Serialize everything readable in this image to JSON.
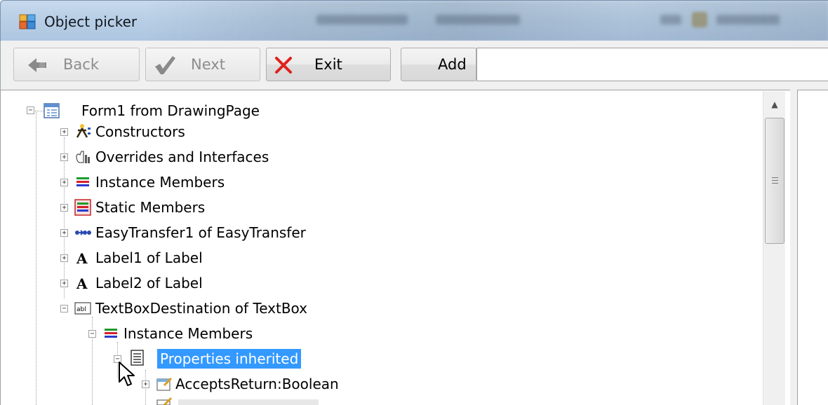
{
  "window": {
    "title": "Object picker"
  },
  "toolbar": {
    "back_label": "Back",
    "next_label": "Next",
    "exit_label": "Exit",
    "add_label": "Add",
    "address_value": ""
  },
  "tree": {
    "nodes": [
      {
        "label": "Form1 from DrawingPage",
        "icon": "form-icon",
        "expander": "−"
      },
      {
        "label": "Constructors",
        "icon": "constructors-icon",
        "expander": "+"
      },
      {
        "label": "Overrides and Interfaces",
        "icon": "overrides-icon",
        "expander": "+"
      },
      {
        "label": "Instance Members",
        "icon": "instance-members-icon",
        "expander": "+"
      },
      {
        "label": "Static Members",
        "icon": "static-members-icon",
        "expander": "+"
      },
      {
        "label": "EasyTransfer1 of EasyTransfer",
        "icon": "easytransfer-icon",
        "expander": "+"
      },
      {
        "label": "Label1 of Label",
        "icon": "label-icon",
        "expander": "+"
      },
      {
        "label": "Label2 of Label",
        "icon": "label-icon",
        "expander": "+"
      },
      {
        "label": "TextBoxDestination of TextBox",
        "icon": "textbox-icon",
        "expander": "−"
      },
      {
        "label": "Instance Members",
        "icon": "instance-members-icon",
        "expander": "−"
      },
      {
        "label": "Properties inherited",
        "icon": "properties-icon",
        "expander": "−",
        "selected": true
      },
      {
        "label": "AcceptsReturn:Boolean",
        "icon": "property-icon",
        "expander": "+"
      }
    ]
  },
  "colors": {
    "selection": "#3399ff",
    "exit_x": "#e0201c"
  }
}
